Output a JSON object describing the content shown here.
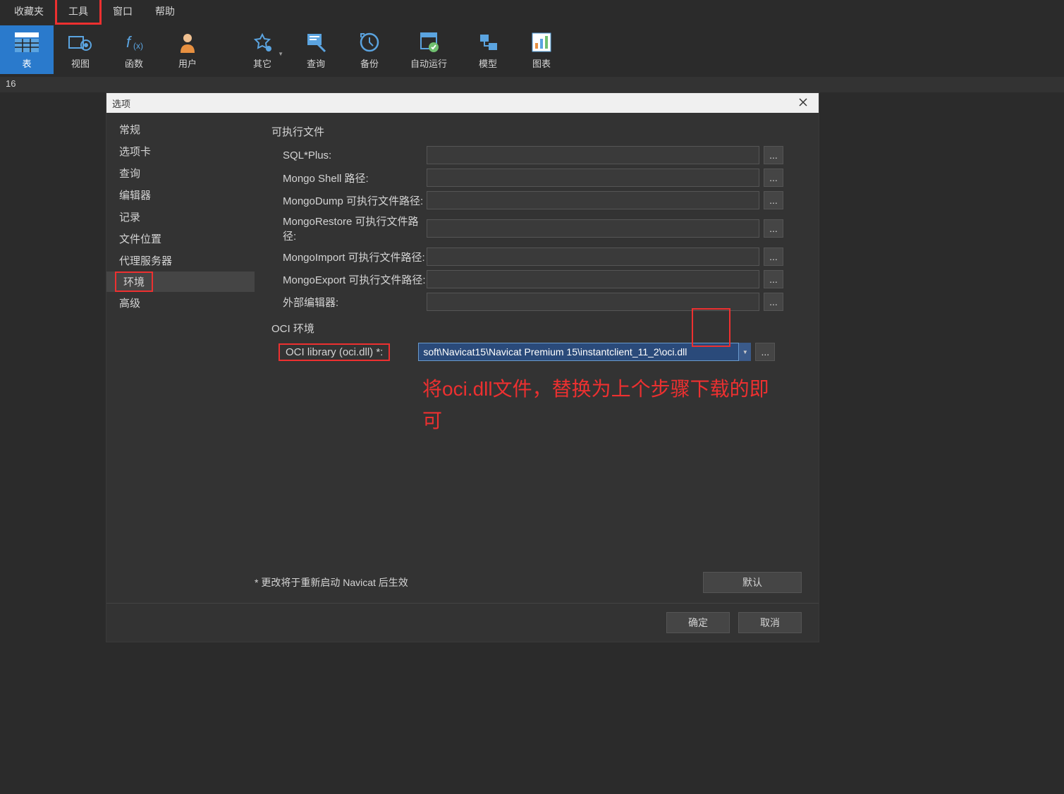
{
  "menubar": {
    "favorites": "收藏夹",
    "tools": "工具",
    "window": "窗口",
    "help": "帮助"
  },
  "toolbar": {
    "table": "表",
    "view": "视图",
    "function": "函数",
    "user": "用户",
    "other": "其它",
    "query": "查询",
    "backup": "备份",
    "autorun": "自动运行",
    "model": "模型",
    "chart": "图表"
  },
  "statusbar": {
    "text": "16"
  },
  "dialog": {
    "title": "选项",
    "sidebar": {
      "general": "常规",
      "tabs": "选项卡",
      "query": "查询",
      "editor": "编辑器",
      "records": "记录",
      "filelocation": "文件位置",
      "proxy": "代理服务器",
      "environment": "环境",
      "advanced": "高级"
    },
    "sections": {
      "executables": "可执行文件",
      "oci_env": "OCI 环境"
    },
    "fields": {
      "sqlplus": "SQL*Plus:",
      "mongoshell": "Mongo Shell 路径:",
      "mongodump": "MongoDump 可执行文件路径:",
      "mongorestore": "MongoRestore 可执行文件路径:",
      "mongoimport": "MongoImport 可执行文件路径:",
      "mongoexport": "MongoExport 可执行文件路径:",
      "external_editor": "外部编辑器:",
      "oci_library": "OCI library (oci.dll) *:"
    },
    "values": {
      "oci_path": "soft\\Navicat15\\Navicat Premium 15\\instantclient_11_2\\oci.dll"
    },
    "browse_btn": "...",
    "note": "* 更改将于重新启动 Navicat 后生效",
    "default_btn": "默认",
    "ok_btn": "确定",
    "cancel_btn": "取消"
  },
  "annotation": "将oci.dll文件，替换为上个步骤下载的即可"
}
